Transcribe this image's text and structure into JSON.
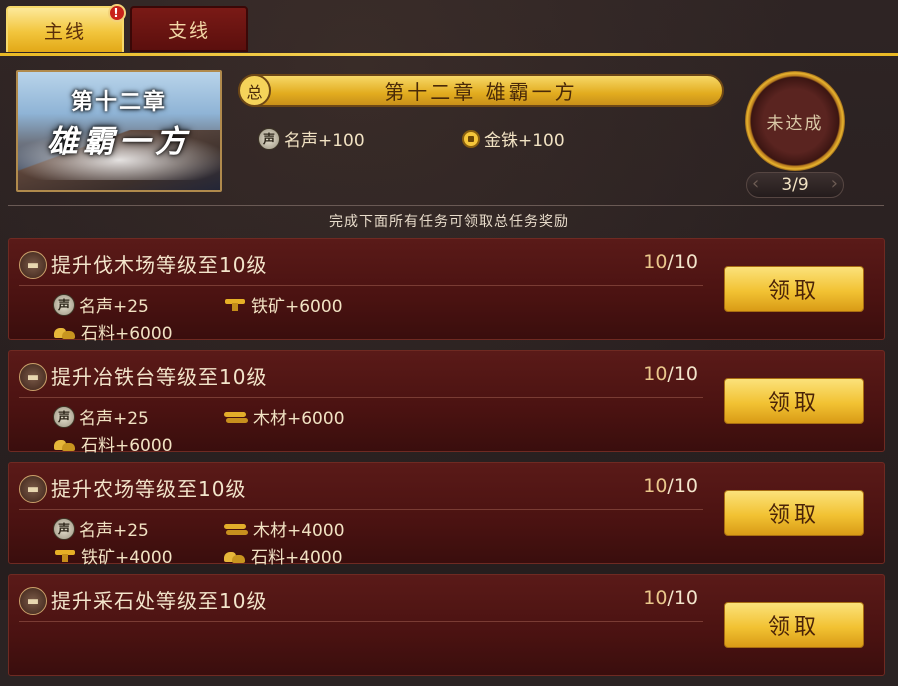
{
  "tabs": [
    {
      "label": "主线",
      "active": true,
      "alert": "!"
    },
    {
      "label": "支线",
      "active": false
    }
  ],
  "chapter": {
    "image_line1": "第十二章",
    "image_line2": "雄霸一方",
    "badge": "总",
    "title": "第十二章  雄霸一方",
    "rewards": [
      {
        "icon": "fame-icon",
        "icon_text": "声",
        "text": "名声+100"
      },
      {
        "icon": "coin-icon",
        "text": "金铢+100"
      }
    ],
    "status": "未达成",
    "progress": "3/9"
  },
  "hint": "完成下面所有任务可领取总任务奖励",
  "tasks": [
    {
      "icon_text": "",
      "title": "提升伐木场等级至10级",
      "current": "10",
      "total": "/10",
      "button": "领取",
      "rewards": [
        {
          "icon": "fame-icon",
          "icon_text": "声",
          "text": "名声+25"
        },
        {
          "icon": "ore-icon",
          "text": "铁矿+6000"
        },
        {
          "icon": "stone-icon",
          "text": "石料+6000"
        }
      ]
    },
    {
      "icon_text": "",
      "title": "提升冶铁台等级至10级",
      "current": "10",
      "total": "/10",
      "button": "领取",
      "rewards": [
        {
          "icon": "fame-icon",
          "icon_text": "声",
          "text": "名声+25"
        },
        {
          "icon": "wood-icon",
          "text": "木材+6000"
        },
        {
          "icon": "stone-icon",
          "text": "石料+6000"
        }
      ]
    },
    {
      "icon_text": "",
      "title": "提升农场等级至10级",
      "current": "10",
      "total": "/10",
      "button": "领取",
      "rewards": [
        {
          "icon": "fame-icon",
          "icon_text": "声",
          "text": "名声+25"
        },
        {
          "icon": "wood-icon",
          "text": "木材+4000"
        },
        {
          "icon": "ore-icon",
          "text": "铁矿+4000"
        },
        {
          "icon": "stone-icon",
          "text": "石料+4000"
        }
      ]
    },
    {
      "icon_text": "",
      "title": "提升采石处等级至10级",
      "current": "10",
      "total": "/10",
      "button": "领取",
      "rewards": []
    }
  ],
  "colors": {
    "gold": "#f2c53c",
    "card_bg": "#4a1211",
    "text": "#f1e2c3"
  }
}
